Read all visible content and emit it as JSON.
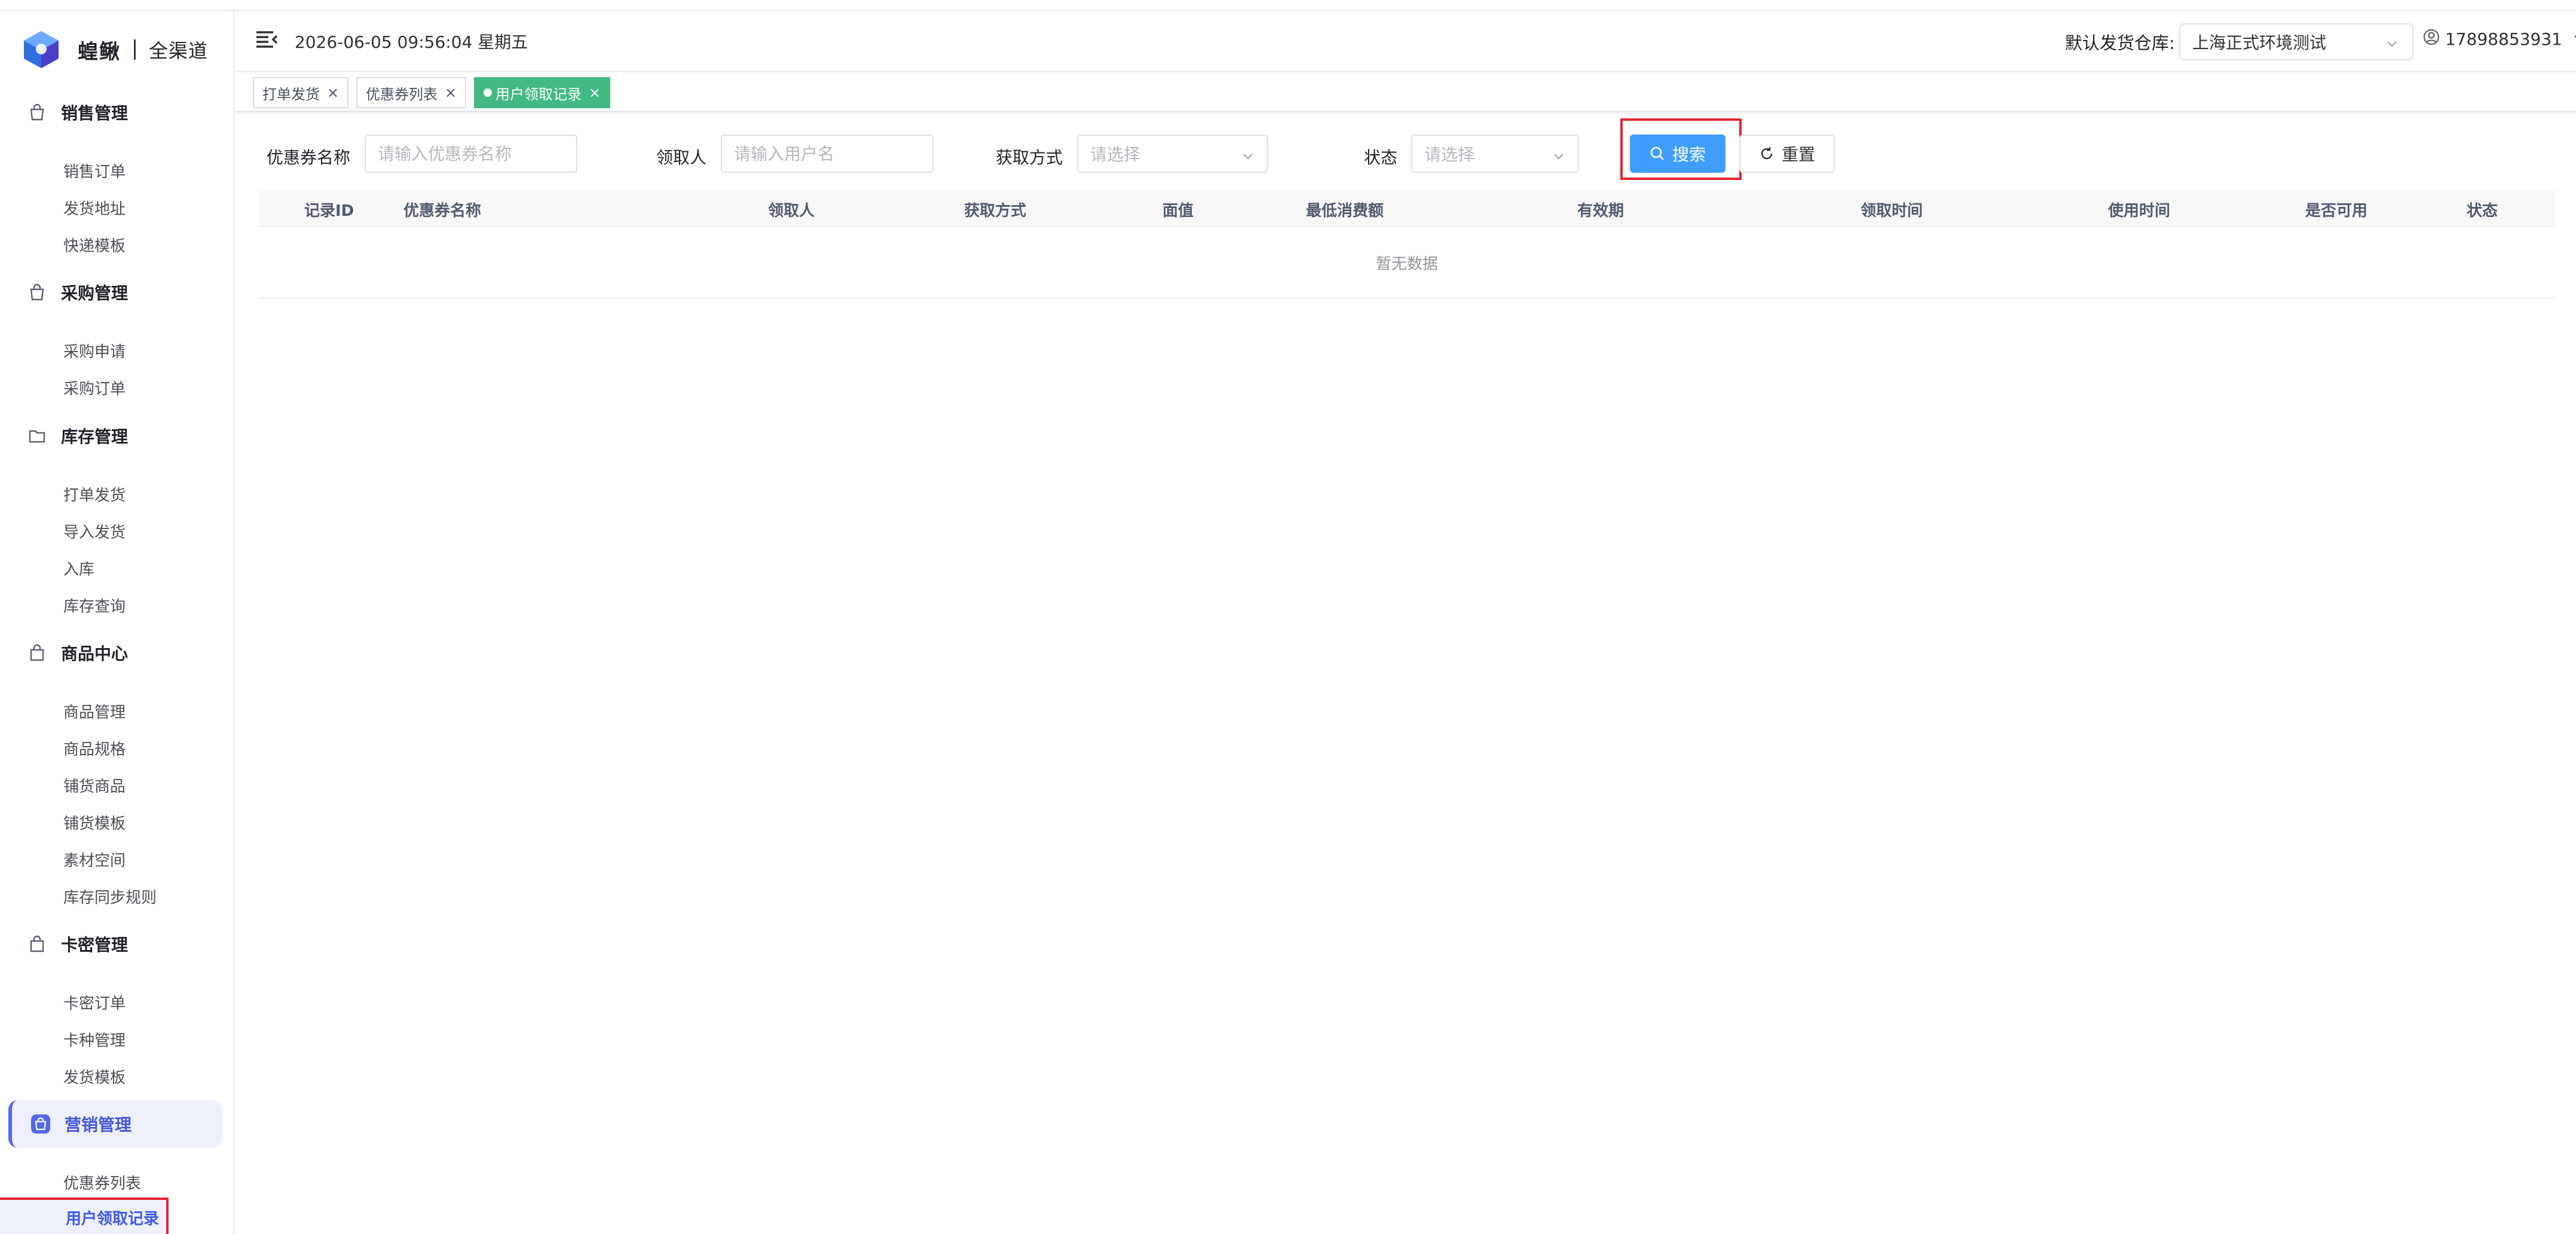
{
  "brand": {
    "name": "蝗鳅",
    "sub": "全渠道"
  },
  "header": {
    "datetime": "2026-06-05 09:56:04 星期五",
    "warehouse_label": "默认发货仓库:",
    "warehouse_value": "上海正式环境测试",
    "username": "17898853931"
  },
  "tags": [
    {
      "label": "打单发货",
      "active": false
    },
    {
      "label": "优惠券列表",
      "active": false
    },
    {
      "label": "用户领取记录",
      "active": true
    }
  ],
  "sidebar": {
    "groups": [
      {
        "label": "销售管理",
        "items": [
          "销售订单",
          "发货地址",
          "快递模板"
        ]
      },
      {
        "label": "采购管理",
        "items": [
          "采购申请",
          "采购订单"
        ]
      },
      {
        "label": "库存管理",
        "items": [
          "打单发货",
          "导入发货",
          "入库",
          "库存查询"
        ]
      },
      {
        "label": "商品中心",
        "items": [
          "商品管理",
          "商品规格",
          "铺货商品",
          "铺货模板",
          "素材空间",
          "库存同步规则"
        ]
      },
      {
        "label": "卡密管理",
        "items": [
          "卡密订单",
          "卡种管理",
          "发货模板"
        ]
      },
      {
        "label": "营销管理",
        "items": [
          "优惠券列表",
          "用户领取记录"
        ]
      }
    ]
  },
  "filters": {
    "coupon_name_label": "优惠券名称",
    "coupon_name_placeholder": "请输入优惠券名称",
    "receiver_label": "领取人",
    "receiver_placeholder": "请输入用户名",
    "method_label": "获取方式",
    "method_placeholder": "请选择",
    "status_label": "状态",
    "status_placeholder": "请选择",
    "search_label": "搜索",
    "reset_label": "重置"
  },
  "table": {
    "columns": [
      "记录ID",
      "优惠券名称",
      "领取人",
      "获取方式",
      "面值",
      "最低消费额",
      "有效期",
      "领取时间",
      "使用时间",
      "是否可用",
      "状态"
    ],
    "empty_text": "暂无数据"
  },
  "colors": {
    "accent": "#409eff",
    "active_tag": "#42b983",
    "highlight": "#e0242f",
    "menu_active": "#3a57e8"
  }
}
